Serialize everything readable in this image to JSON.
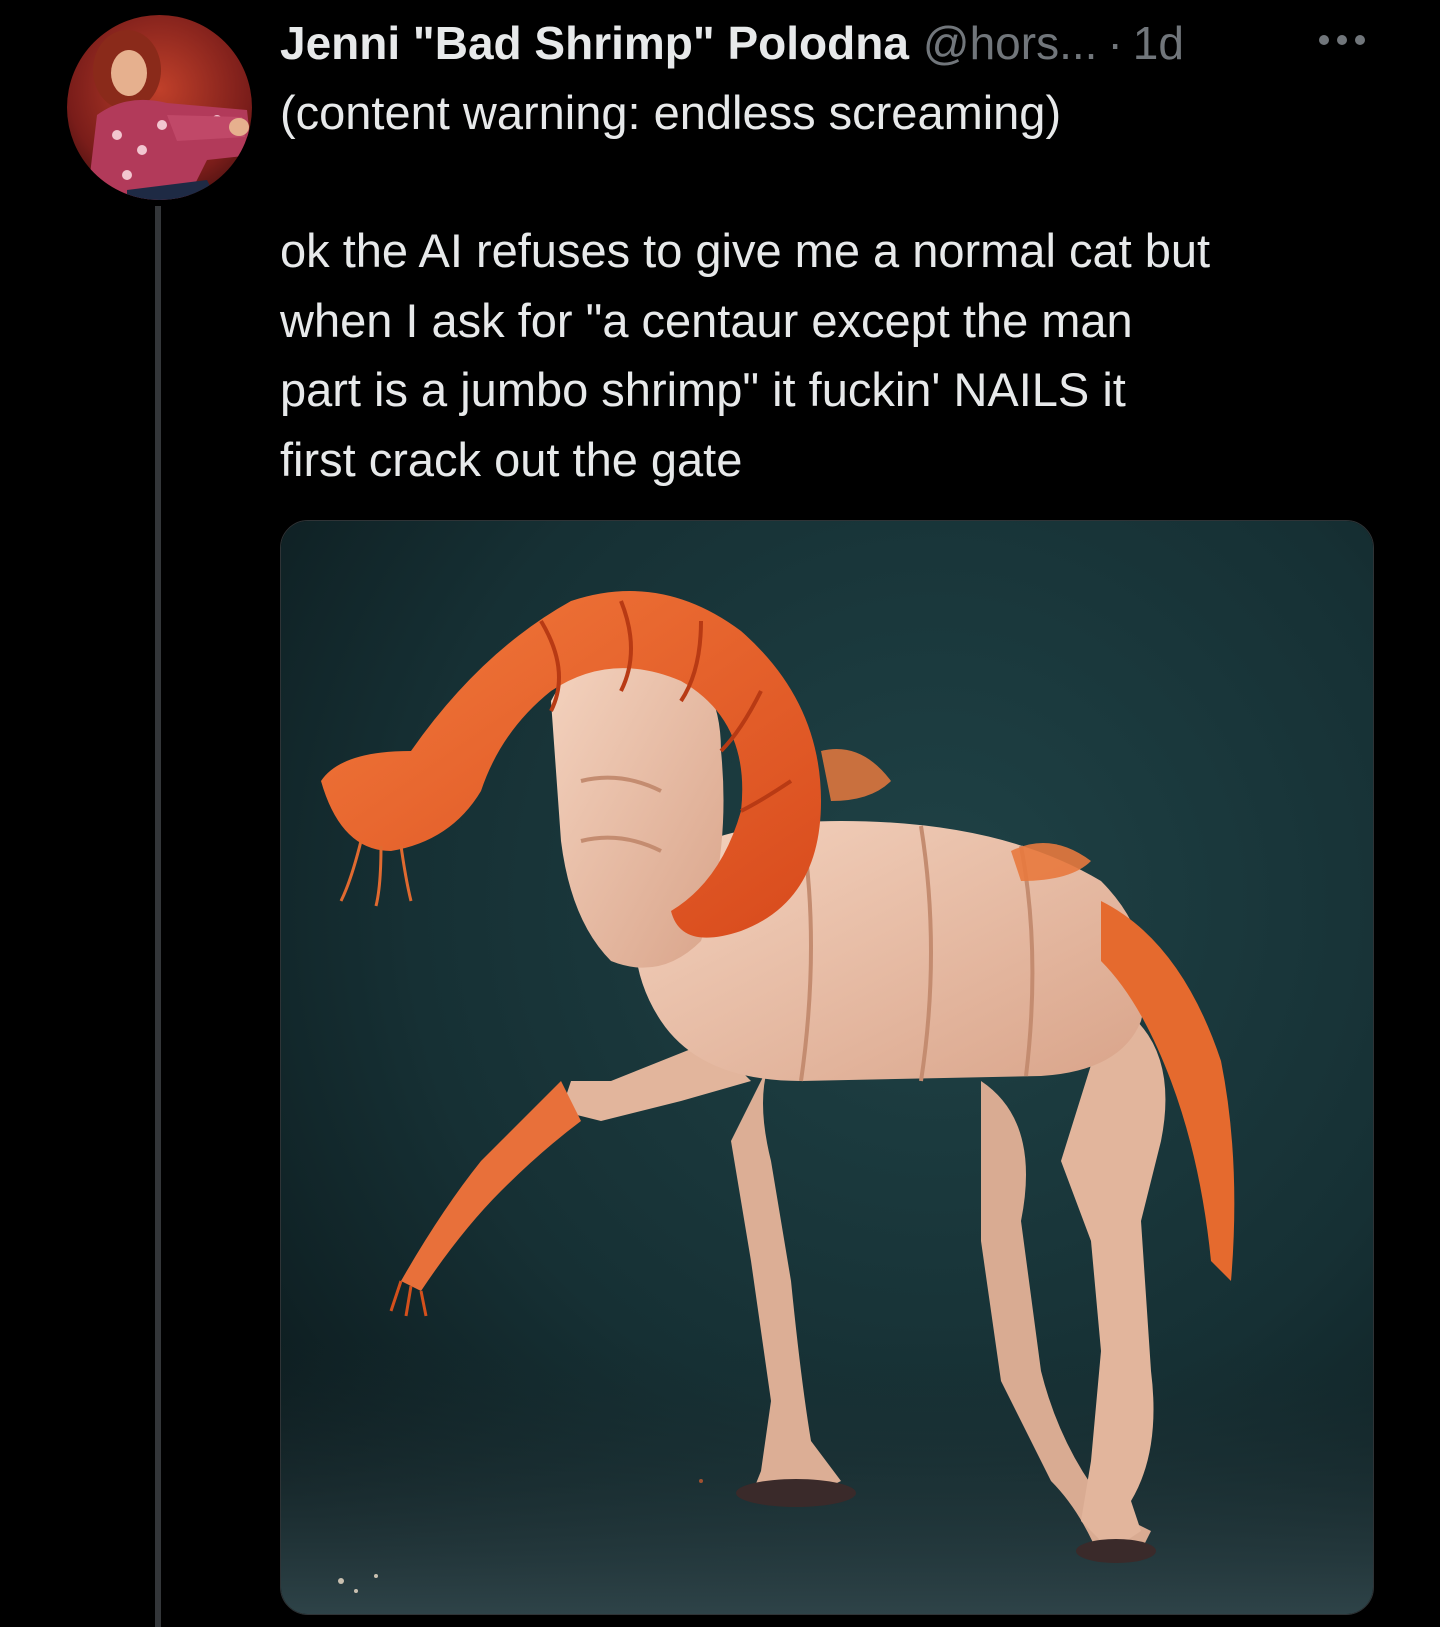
{
  "tweet": {
    "author": {
      "display_name": "Jenni \"Bad Shrimp\" Polodna",
      "handle": "@hors...",
      "avatar_icon": "user-avatar"
    },
    "separator": "·",
    "timestamp": "1d",
    "more_icon": "more-horizontal-icon",
    "content_warning": "(content warning: endless screaming)",
    "body_lines": [
      "ok the AI refuses to give me a normal cat but",
      "when I ask for \"a centaur except the man",
      "part is a jumbo shrimp\" it fuckin' NAILS it",
      "first crack out the gate"
    ],
    "media": {
      "type": "image",
      "subject_icon": "shrimp-centaur-image"
    }
  },
  "colors": {
    "background": "#000000",
    "text_primary": "#e7e9ea",
    "text_secondary": "#71767b",
    "thread_line": "#333639",
    "shrimp_orange": "#ef6a2e",
    "image_background": "#1c3a3e"
  }
}
